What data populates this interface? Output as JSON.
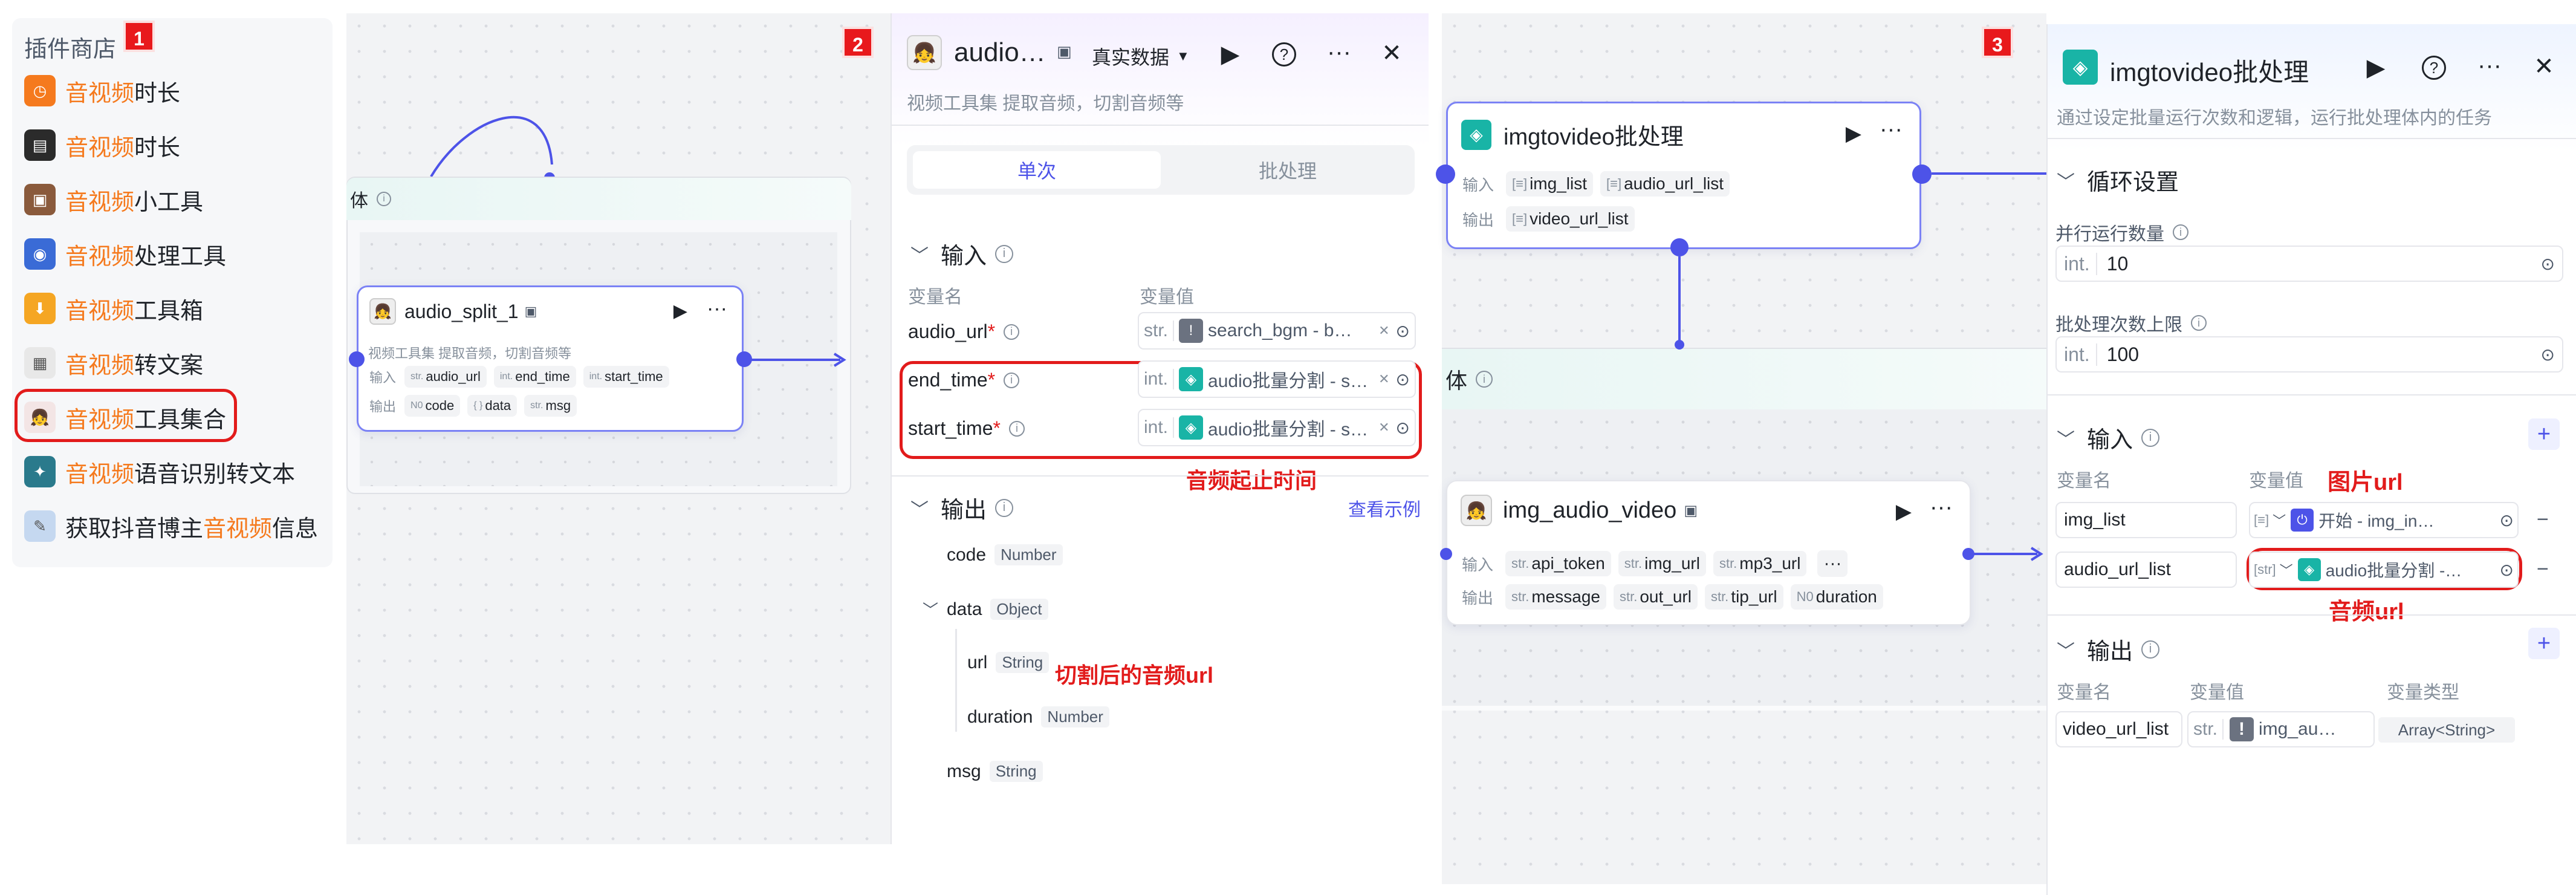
{
  "left": {
    "title": "插件商店",
    "badge": "1",
    "items": [
      {
        "hl": "音视频",
        "rest": "时长"
      },
      {
        "hl": "音视频",
        "rest": "时长"
      },
      {
        "hl": "音视频",
        "rest": "小工具"
      },
      {
        "hl": "音视频",
        "rest": "处理工具"
      },
      {
        "hl": "音视频",
        "rest": "工具箱"
      },
      {
        "hl": "音视频",
        "rest": "转文案"
      },
      {
        "hl": "音视频",
        "rest": "工具集合"
      },
      {
        "hl": "音视频",
        "rest": "语音识别转文本"
      },
      {
        "pre": "获取抖音博主",
        "hl": "音视频",
        "rest": "信息"
      }
    ]
  },
  "canvas1": {
    "loop_label": "体",
    "node": {
      "title": "audio_split_1",
      "desc": "视频工具集 提取音频，切割音频等",
      "in_label": "输入",
      "out_label": "输出",
      "inputs": [
        {
          "t": "str.",
          "n": "audio_url"
        },
        {
          "t": "int.",
          "n": "end_time"
        },
        {
          "t": "int.",
          "n": "start_time"
        }
      ],
      "outputs": [
        {
          "t": "N0",
          "n": "code"
        },
        {
          "t": "{ }",
          "n": "data"
        },
        {
          "t": "str.",
          "n": "msg"
        }
      ]
    }
  },
  "panel2": {
    "badge": "2",
    "title": "audio…",
    "data_mode": "真实数据",
    "desc": "视频工具集 提取音频，切割音频等",
    "tab_single": "单次",
    "tab_batch": "批处理",
    "input_section": "输入",
    "col_name": "变量名",
    "col_value": "变量值",
    "rows": [
      {
        "name": "audio_url",
        "type": "str.",
        "value": "search_bgm - b…"
      },
      {
        "name": "end_time",
        "type": "int.",
        "value": "audio批量分割 - s…"
      },
      {
        "name": "start_time",
        "type": "int.",
        "value": "audio批量分割 - s…"
      }
    ],
    "annotation_time": "音频起止时间",
    "output_section": "输出",
    "view_example": "查看示例",
    "outputs": [
      {
        "name": "code",
        "type": "Number"
      },
      {
        "name": "data",
        "type": "Object"
      },
      {
        "name": "url",
        "type": "String"
      },
      {
        "name": "duration",
        "type": "Number"
      },
      {
        "name": "msg",
        "type": "String"
      }
    ],
    "annotation_url": "切割后的音频url"
  },
  "canvas3": {
    "badge": "3",
    "loop_label": "体",
    "batch_node": {
      "title": "imgtovideo批处理",
      "in_label": "输入",
      "out_label": "输出",
      "inputs": [
        {
          "t": "[≡]",
          "n": "img_list"
        },
        {
          "t": "[≡]",
          "n": "audio_url_list"
        }
      ],
      "outputs": [
        {
          "t": "[≡]",
          "n": "video_url_list"
        }
      ]
    },
    "inner_node": {
      "title": "img_audio_video",
      "in_label": "输入",
      "out_label": "输出",
      "inputs": [
        {
          "t": "str.",
          "n": "api_token"
        },
        {
          "t": "str.",
          "n": "img_url"
        },
        {
          "t": "str.",
          "n": "mp3_url"
        }
      ],
      "outputs": [
        {
          "t": "str.",
          "n": "message"
        },
        {
          "t": "str.",
          "n": "out_url"
        },
        {
          "t": "str.",
          "n": "tip_url"
        },
        {
          "t": "N0",
          "n": "duration"
        }
      ]
    }
  },
  "panel3": {
    "title": "imgtovideo批处理",
    "desc": "通过设定批量运行次数和逻辑，运行批处理体内的任务",
    "loop_section": "循环设置",
    "parallel_label": "并行运行数量",
    "parallel_type": "int.",
    "parallel_value": "10",
    "max_label": "批处理次数上限",
    "max_type": "int.",
    "max_value": "100",
    "input_section": "输入",
    "col_name": "变量名",
    "col_value": "变量值",
    "ann_img": "图片url",
    "in_rows": [
      {
        "name": "img_list",
        "type": "[≡]",
        "value": "开始 - img_in…"
      },
      {
        "name": "audio_url_list",
        "type": "[str]",
        "value": "audio批量分割 -…"
      }
    ],
    "ann_audio": "音频url",
    "output_section": "输出",
    "out_col_name": "变量名",
    "out_col_value": "变量值",
    "out_col_type": "变量类型",
    "out_row": {
      "name": "video_url_list",
      "type": "str.",
      "value": "img_au…",
      "vtype": "Array<String>"
    }
  }
}
